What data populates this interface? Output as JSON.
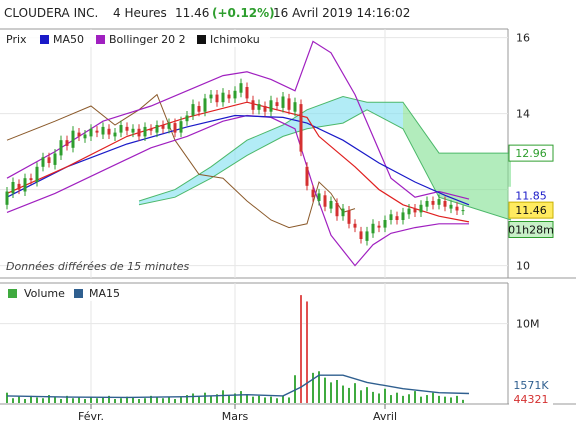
{
  "header": {
    "symbol": "CLOUDERA INC.",
    "period": "4 Heures",
    "last": "11.46",
    "change": "(+0.12%)",
    "datetime": "16 Avril 2019 14:16:02"
  },
  "legend_top": [
    {
      "label": "Prix",
      "color": "#c83a3a"
    },
    {
      "label": "MA50",
      "color": "#1a1ac8"
    },
    {
      "label": "Bollinger 20 2",
      "color": "#a020c0"
    },
    {
      "label": "Ichimoku",
      "color": "#111111"
    }
  ],
  "legend_bottom": [
    {
      "label": "Volume",
      "color": "#3faa3f"
    },
    {
      "label": "MA15",
      "color": "#2f5f8f"
    }
  ],
  "note": "Données différées de 15 minutes",
  "colors": {
    "up": "#2e9e2e",
    "down": "#d43030",
    "ma50": "#1a1ac8",
    "bollinger": "#a020c0",
    "kijun": "#e02020",
    "chikou": "#8b5a2b",
    "cloud_bull": "#7fe08f",
    "cloud_bear": "#7fe0f0",
    "volume": "#3faa3f",
    "ma15": "#2f5f8f"
  },
  "price_tags": [
    {
      "label": "12.96",
      "value": 12.96,
      "bg": "#ffffff",
      "fg": "#2e9e2e",
      "border": "#2e9e2e"
    },
    {
      "label": "11.85",
      "value": 11.85,
      "bg": "#ffffff",
      "fg": "#1a1ac8",
      "border": "#ffffff"
    },
    {
      "label": "11.46",
      "value": 11.46,
      "bg": "#ffeb60",
      "fg": "#111111",
      "border": "#c8b000"
    },
    {
      "label": "01h28m",
      "value": 10.95,
      "bg": "#c8f0c8",
      "fg": "#111111",
      "border": "#2e9e2e"
    }
  ],
  "volume_tags": [
    {
      "label": "1571K",
      "value": 1571,
      "bg": "#ffffff",
      "fg": "#2f5f8f"
    },
    {
      "label": "44321",
      "value": 44,
      "bg": "#ffffff",
      "fg": "#d43030"
    }
  ],
  "chart_data": [
    {
      "type": "candlestick",
      "title": "CLOUDERA INC.",
      "x_ticks": [
        {
          "label": "Févr.",
          "i": 14
        },
        {
          "label": "Mars",
          "i": 38
        },
        {
          "label": "Avril",
          "i": 63
        }
      ],
      "y_ticks": [
        10,
        14,
        16
      ],
      "ylim": [
        9.7,
        16.2
      ],
      "candles": [
        [
          11.6,
          11.95
        ],
        [
          11.9,
          12.2
        ],
        [
          12.15,
          12.0
        ],
        [
          11.95,
          12.3
        ],
        [
          12.3,
          12.25
        ],
        [
          12.2,
          12.6
        ],
        [
          12.6,
          12.85
        ],
        [
          12.85,
          12.7
        ],
        [
          12.65,
          12.95
        ],
        [
          12.9,
          13.3
        ],
        [
          13.3,
          13.15
        ],
        [
          13.1,
          13.55
        ],
        [
          13.5,
          13.4
        ],
        [
          13.35,
          13.45
        ],
        [
          13.4,
          13.6
        ],
        [
          13.55,
          13.5
        ],
        [
          13.45,
          13.65
        ],
        [
          13.6,
          13.45
        ],
        [
          13.4,
          13.5
        ],
        [
          13.5,
          13.7
        ],
        [
          13.65,
          13.55
        ],
        [
          13.5,
          13.6
        ],
        [
          13.6,
          13.4
        ],
        [
          13.4,
          13.65
        ],
        [
          13.6,
          13.55
        ],
        [
          13.5,
          13.7
        ],
        [
          13.7,
          13.6
        ],
        [
          13.6,
          13.75
        ],
        [
          13.75,
          13.5
        ],
        [
          13.5,
          13.8
        ],
        [
          13.8,
          13.95
        ],
        [
          13.95,
          14.25
        ],
        [
          14.2,
          14.05
        ],
        [
          14.05,
          14.4
        ],
        [
          14.4,
          14.5
        ],
        [
          14.5,
          14.3
        ],
        [
          14.3,
          14.55
        ],
        [
          14.5,
          14.4
        ],
        [
          14.4,
          14.6
        ],
        [
          14.55,
          14.8
        ],
        [
          14.7,
          14.4
        ],
        [
          14.35,
          14.1
        ],
        [
          14.1,
          14.25
        ],
        [
          14.2,
          14.05
        ],
        [
          14.05,
          14.35
        ],
        [
          14.3,
          14.2
        ],
        [
          14.15,
          14.45
        ],
        [
          14.4,
          14.1
        ],
        [
          14.05,
          14.3
        ],
        [
          14.25,
          13.0
        ],
        [
          12.6,
          12.1
        ],
        [
          12.0,
          11.8
        ],
        [
          11.7,
          11.9
        ],
        [
          11.85,
          11.55
        ],
        [
          11.5,
          11.7
        ],
        [
          11.65,
          11.3
        ],
        [
          11.3,
          11.5
        ],
        [
          11.45,
          11.1
        ],
        [
          11.1,
          11.0
        ],
        [
          10.9,
          10.7
        ],
        [
          10.65,
          10.9
        ],
        [
          10.85,
          11.1
        ],
        [
          11.05,
          11.0
        ],
        [
          11.0,
          11.2
        ],
        [
          11.2,
          11.35
        ],
        [
          11.3,
          11.2
        ],
        [
          11.2,
          11.4
        ],
        [
          11.35,
          11.5
        ],
        [
          11.5,
          11.4
        ],
        [
          11.4,
          11.6
        ],
        [
          11.55,
          11.7
        ],
        [
          11.7,
          11.6
        ],
        [
          11.6,
          11.75
        ],
        [
          11.7,
          11.55
        ],
        [
          11.5,
          11.6
        ],
        [
          11.55,
          11.45
        ],
        [
          11.45,
          11.46
        ]
      ],
      "ma50": [
        [
          0,
          11.8
        ],
        [
          10,
          12.6
        ],
        [
          20,
          13.2
        ],
        [
          30,
          13.65
        ],
        [
          38,
          13.95
        ],
        [
          46,
          13.9
        ],
        [
          50,
          13.75
        ],
        [
          56,
          13.3
        ],
        [
          62,
          12.7
        ],
        [
          68,
          12.2
        ],
        [
          73,
          11.85
        ],
        [
          77,
          11.6
        ]
      ],
      "bollinger_upper": [
        [
          0,
          12.3
        ],
        [
          8,
          13.0
        ],
        [
          16,
          13.8
        ],
        [
          24,
          14.2
        ],
        [
          30,
          14.6
        ],
        [
          36,
          15.0
        ],
        [
          40,
          15.1
        ],
        [
          44,
          14.9
        ],
        [
          48,
          14.6
        ],
        [
          51,
          15.9
        ],
        [
          54,
          15.6
        ],
        [
          58,
          14.5
        ],
        [
          61,
          13.4
        ],
        [
          64,
          12.3
        ],
        [
          68,
          11.8
        ],
        [
          72,
          11.95
        ],
        [
          77,
          11.75
        ]
      ],
      "bollinger_lower": [
        [
          0,
          11.4
        ],
        [
          8,
          11.9
        ],
        [
          16,
          12.5
        ],
        [
          24,
          13.1
        ],
        [
          30,
          13.4
        ],
        [
          36,
          13.8
        ],
        [
          40,
          13.95
        ],
        [
          44,
          13.9
        ],
        [
          48,
          13.6
        ],
        [
          51,
          12.1
        ],
        [
          54,
          10.8
        ],
        [
          58,
          10.0
        ],
        [
          61,
          10.55
        ],
        [
          64,
          10.85
        ],
        [
          68,
          11.0
        ],
        [
          72,
          11.1
        ],
        [
          77,
          11.1
        ]
      ],
      "kijun": [
        [
          0,
          11.9
        ],
        [
          10,
          12.6
        ],
        [
          20,
          13.4
        ],
        [
          30,
          13.9
        ],
        [
          40,
          14.3
        ],
        [
          50,
          13.9
        ],
        [
          52,
          13.4
        ],
        [
          58,
          12.6
        ],
        [
          62,
          12.0
        ],
        [
          66,
          11.6
        ],
        [
          72,
          11.3
        ],
        [
          77,
          11.15
        ]
      ],
      "chikou": [
        [
          0,
          13.3
        ],
        [
          8,
          13.8
        ],
        [
          14,
          14.2
        ],
        [
          18,
          13.7
        ],
        [
          22,
          14.1
        ],
        [
          25,
          14.5
        ],
        [
          28,
          13.3
        ],
        [
          32,
          12.4
        ],
        [
          36,
          12.3
        ],
        [
          40,
          11.7
        ],
        [
          44,
          11.2
        ],
        [
          47,
          11.0
        ],
        [
          50,
          11.1
        ],
        [
          52,
          12.2
        ],
        [
          54,
          11.9
        ],
        [
          56,
          11.4
        ],
        [
          58,
          11.5
        ]
      ],
      "cloud_a": [
        [
          22,
          11.7
        ],
        [
          28,
          12.0
        ],
        [
          34,
          12.6
        ],
        [
          40,
          13.3
        ],
        [
          46,
          13.7
        ],
        [
          50,
          14.1
        ],
        [
          56,
          14.45
        ],
        [
          60,
          14.3
        ],
        [
          66,
          14.3
        ],
        [
          72,
          12.96
        ],
        [
          84,
          12.96
        ]
      ],
      "cloud_b": [
        [
          22,
          11.6
        ],
        [
          28,
          11.8
        ],
        [
          34,
          12.3
        ],
        [
          40,
          12.9
        ],
        [
          46,
          13.4
        ],
        [
          50,
          13.6
        ],
        [
          56,
          13.75
        ],
        [
          60,
          14.1
        ],
        [
          66,
          13.6
        ],
        [
          72,
          11.8
        ],
        [
          78,
          11.5
        ],
        [
          84,
          11.2
        ]
      ]
    },
    {
      "type": "bar",
      "title": "Volume",
      "y_ticks": [
        {
          "label": "10M",
          "value": 10
        }
      ],
      "ylim": [
        0,
        15
      ],
      "values": [
        1.3,
        0.6,
        0.8,
        0.5,
        0.9,
        0.7,
        0.6,
        1.0,
        0.8,
        0.5,
        0.9,
        0.6,
        0.7,
        0.5,
        0.8,
        0.6,
        0.7,
        0.9,
        0.5,
        0.6,
        0.8,
        0.7,
        0.5,
        0.6,
        0.9,
        0.7,
        0.6,
        0.8,
        0.5,
        0.7,
        1.0,
        1.2,
        0.8,
        1.3,
        0.9,
        1.1,
        1.6,
        0.9,
        1.2,
        1.5,
        1.0,
        0.8,
        0.9,
        0.7,
        0.8,
        0.6,
        0.9,
        0.7,
        3.5,
        13.6,
        12.8,
        3.8,
        4.0,
        3.2,
        2.6,
        2.9,
        2.2,
        1.9,
        2.5,
        1.6,
        2.0,
        1.4,
        1.2,
        1.8,
        1.0,
        1.3,
        0.9,
        1.1,
        1.5,
        0.8,
        1.0,
        1.3,
        0.9,
        0.8,
        0.7,
        0.9,
        0.4
      ],
      "ma15": [
        [
          0,
          0.9
        ],
        [
          10,
          0.75
        ],
        [
          20,
          0.7
        ],
        [
          30,
          0.8
        ],
        [
          40,
          1.05
        ],
        [
          46,
          0.9
        ],
        [
          49,
          2.0
        ],
        [
          52,
          3.5
        ],
        [
          56,
          3.5
        ],
        [
          60,
          2.6
        ],
        [
          66,
          1.8
        ],
        [
          72,
          1.3
        ],
        [
          77,
          1.2
        ]
      ]
    }
  ]
}
